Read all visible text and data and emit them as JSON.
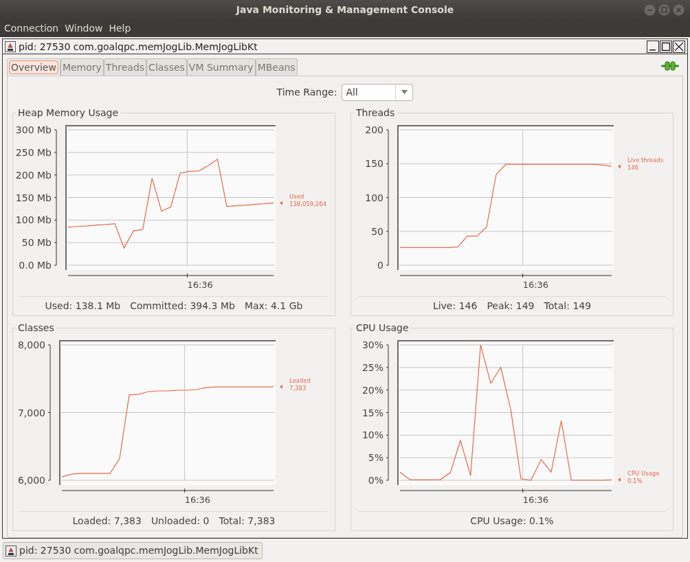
{
  "window": {
    "title": "Java Monitoring & Management Console"
  },
  "menu": [
    {
      "label": "Connection"
    },
    {
      "label": "Window"
    },
    {
      "label": "Help"
    }
  ],
  "internal_frame": {
    "title": "pid: 27530 com.goalqpc.memJogLib.MemJogLibKt"
  },
  "tabs": [
    {
      "label": "Overview",
      "selected": true
    },
    {
      "label": "Memory",
      "selected": false
    },
    {
      "label": "Threads",
      "selected": false
    },
    {
      "label": "Classes",
      "selected": false
    },
    {
      "label": "VM Summary",
      "selected": false
    },
    {
      "label": "MBeans",
      "selected": false
    }
  ],
  "time_range": {
    "label": "Time Range:",
    "value": "All"
  },
  "panels": [
    {
      "title": "Heap Memory Usage",
      "summary": [
        "Used: 138.1 Mb",
        "Committed: 394.3 Mb",
        "Max: 4.1 Gb"
      ],
      "chart_data": {
        "type": "line",
        "grid": true,
        "series": [
          {
            "name": "Used",
            "color": "#e8694b",
            "values": [
              84,
              86,
              87,
              89,
              90,
              92,
              38,
              76,
              79,
              193,
              120,
              129,
              204,
              208,
              209,
              221,
              235,
              130,
              132,
              133,
              135,
              136,
              138
            ]
          }
        ],
        "ylim": [
          0,
          300
        ],
        "yticks": [
          {
            "value": 0,
            "label": "0.0 Mb"
          },
          {
            "value": 50,
            "label": "50 Mb"
          },
          {
            "value": 100,
            "label": "100 Mb"
          },
          {
            "value": 150,
            "label": "150 Mb"
          },
          {
            "value": 200,
            "label": "200 Mb"
          },
          {
            "value": 250,
            "label": "250 Mb"
          },
          {
            "value": 300,
            "label": "300 Mb"
          }
        ],
        "annotations": [
          "16:36",
          "138,059,264"
        ]
      }
    },
    {
      "title": "Threads",
      "summary": [
        "Live: 146",
        "Peak: 149",
        "Total: 149"
      ],
      "chart_data": {
        "type": "line",
        "grid": true,
        "series": [
          {
            "name": "Live threads",
            "color": "#e8694b",
            "values": [
              26,
              26,
              26,
              26,
              26,
              26,
              27,
              43,
              43,
              56,
              134,
              149,
              149,
              149,
              149,
              149,
              149,
              149,
              149,
              149,
              149,
              148,
              146
            ]
          }
        ],
        "ylim": [
          0,
          200
        ],
        "yticks": [
          {
            "value": 0,
            "label": "0"
          },
          {
            "value": 50,
            "label": "50"
          },
          {
            "value": 100,
            "label": "100"
          },
          {
            "value": 150,
            "label": "150"
          },
          {
            "value": 200,
            "label": "200"
          }
        ],
        "annotations": [
          "16:36",
          "146"
        ]
      }
    },
    {
      "title": "Classes",
      "summary": [
        "Loaded: 7,383",
        "Unloaded: 0",
        "Total: 7,383"
      ],
      "chart_data": {
        "type": "line",
        "grid": true,
        "series": [
          {
            "name": "Loaded",
            "color": "#e8694b",
            "values": [
              6050,
              6090,
              6100,
              6100,
              6100,
              6100,
              6320,
              7260,
              7270,
              7310,
              7320,
              7320,
              7330,
              7330,
              7340,
              7370,
              7380,
              7380,
              7380,
              7380,
              7380,
              7380,
              7380
            ]
          }
        ],
        "ylim": [
          6000,
          8000
        ],
        "yticks": [
          {
            "value": 6000,
            "label": "6,000"
          },
          {
            "value": 7000,
            "label": "7,000"
          },
          {
            "value": 8000,
            "label": "8,000"
          }
        ],
        "annotations": [
          "16:36",
          "7,383"
        ]
      }
    },
    {
      "title": "CPU Usage",
      "summary": [
        "CPU Usage: 0.1%"
      ],
      "chart_data": {
        "type": "line",
        "grid": true,
        "series": [
          {
            "name": "CPU Usage",
            "color": "#e8694b",
            "values": [
              1.8,
              0.1,
              0.1,
              0.1,
              0.1,
              1.7,
              8.8,
              1.0,
              30,
              21.5,
              25,
              15.6,
              0.3,
              0,
              4.6,
              1.8,
              13.2,
              0,
              0,
              0,
              0,
              0.1
            ]
          }
        ],
        "ylim": [
          0,
          30
        ],
        "yticks": [
          {
            "value": 0,
            "label": "0%"
          },
          {
            "value": 5,
            "label": "5%"
          },
          {
            "value": 10,
            "label": "10%"
          },
          {
            "value": 15,
            "label": "15%"
          },
          {
            "value": 20,
            "label": "20%"
          },
          {
            "value": 25,
            "label": "25%"
          },
          {
            "value": 30,
            "label": "30%"
          }
        ],
        "annotations": [
          "16:36",
          "0.1%"
        ]
      }
    }
  ],
  "taskbar": {
    "label": "pid: 27530 com.goalqpc.memJogLib.MemJogLibKt"
  }
}
